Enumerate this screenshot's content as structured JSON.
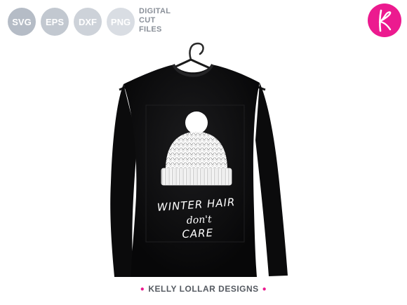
{
  "formats": [
    "SVG",
    "EPS",
    "DXF",
    "PNG"
  ],
  "digital_label": [
    "DIGITAL",
    "CUT",
    "FILES"
  ],
  "logo_letter": "K",
  "design_text": {
    "line1": "WINTER HAIR",
    "line2": "don't",
    "line3": "CARE"
  },
  "brand": "KELLY LOLLAR DESIGNS",
  "colors": {
    "accent": "#ec1a8f",
    "shirt": "#0e0e0f",
    "badge": "#b5bcc6"
  },
  "icons": [
    "hanger-icon",
    "beanie-icon",
    "pompom-icon",
    "logo-k-icon"
  ]
}
